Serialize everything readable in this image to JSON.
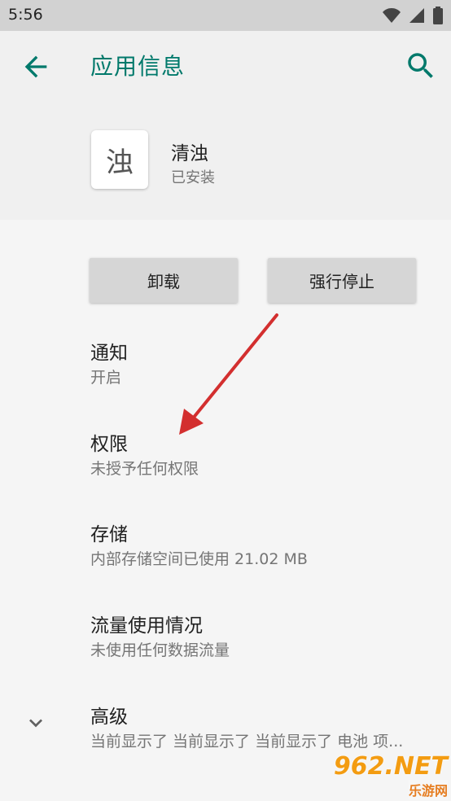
{
  "status": {
    "time": "5:56",
    "icons": [
      "wifi-icon",
      "signal-icon",
      "battery-icon"
    ]
  },
  "appbar": {
    "title": "应用信息",
    "back_icon": "back-arrow-icon",
    "search_icon": "search-icon"
  },
  "app": {
    "icon_glyph": "浊",
    "name": "清浊",
    "status": "已安装"
  },
  "buttons": {
    "uninstall": "卸载",
    "force_stop": "强行停止"
  },
  "settings": [
    {
      "title": "通知",
      "subtitle": "开启"
    },
    {
      "title": "权限",
      "subtitle": "未授予任何权限"
    },
    {
      "title": "存储",
      "subtitle": "内部存储空间已使用 21.02 MB"
    },
    {
      "title": "流量使用情况",
      "subtitle": "未使用任何数据流量"
    },
    {
      "title": "高级",
      "subtitle": "当前显示了 当前显示了 当前显示了 电池 项..."
    }
  ],
  "watermark": {
    "logo": "962.NET",
    "sub": "乐游网"
  },
  "colors": {
    "accent": "#00796b",
    "annotation_arrow": "#d32f2f"
  }
}
